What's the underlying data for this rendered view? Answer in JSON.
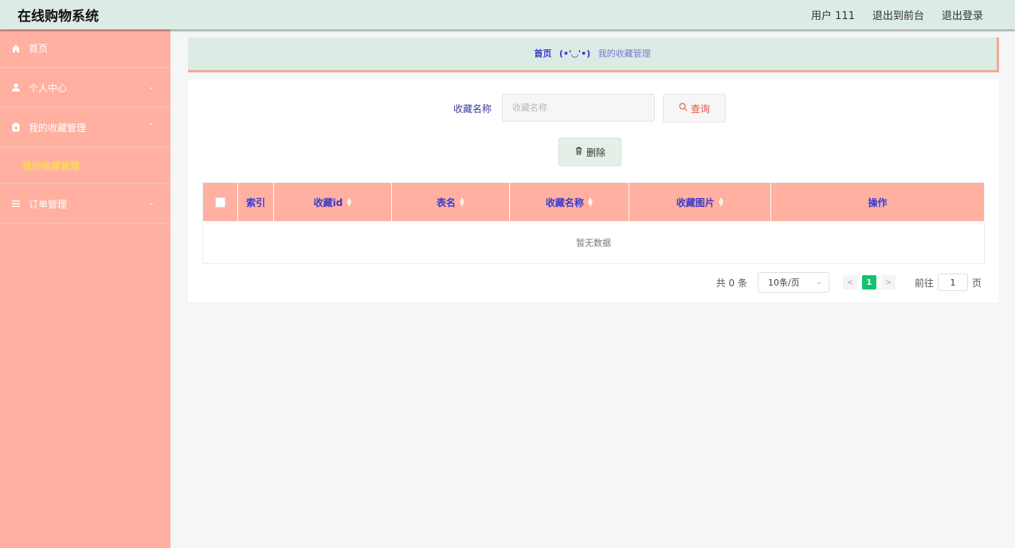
{
  "app": {
    "title": "在线购物系统"
  },
  "topbar": {
    "user_label": "用户 111",
    "to_front": "退出到前台",
    "logout": "退出登录"
  },
  "sidebar": {
    "items": [
      {
        "label": "首页",
        "icon": "home-icon"
      },
      {
        "label": "个人中心",
        "icon": "user-icon"
      },
      {
        "label": "我的收藏管理",
        "icon": "clipboard-icon"
      },
      {
        "label": "订单管理",
        "icon": "list-icon"
      }
    ],
    "submenu_active": "我的收藏管理"
  },
  "breadcrumb": {
    "home": "首页",
    "separator": "(•'◡'•)",
    "current": "我的收藏管理"
  },
  "search": {
    "label": "收藏名称",
    "placeholder": "收藏名称",
    "query_button": "查询"
  },
  "actions": {
    "delete_button": "删除"
  },
  "table": {
    "columns": [
      "索引",
      "收藏id",
      "表名",
      "收藏名称",
      "收藏图片",
      "操作"
    ],
    "empty_text": "暂无数据"
  },
  "pagination": {
    "total": "共 0 条",
    "page_size": "10条/页",
    "current_page": "1",
    "goto_prefix": "前往",
    "goto_value": "1",
    "goto_suffix": "页"
  },
  "colors": {
    "sidebar": "#ffb0a0",
    "header_bg": "#dcebe3",
    "accent": "#13c26f",
    "highlight": "#ffea3a"
  }
}
